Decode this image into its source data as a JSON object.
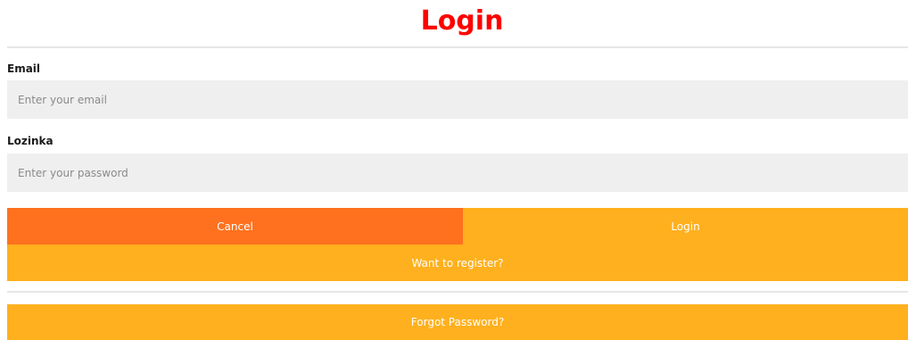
{
  "header": {
    "title": "Login"
  },
  "form": {
    "email_label": "Email",
    "email_placeholder": "Enter your email",
    "email_value": "",
    "password_label": "Lozinka",
    "password_placeholder": "Enter your password",
    "password_value": ""
  },
  "actions": {
    "cancel_label": "Cancel",
    "login_label": "Login",
    "register_label": "Want to register?",
    "forgot_label": "Forgot Password?"
  },
  "colors": {
    "title": "#ff0000",
    "cancel_button": "#ff711e",
    "primary_button": "#ffb01e",
    "input_background": "#efefef"
  }
}
